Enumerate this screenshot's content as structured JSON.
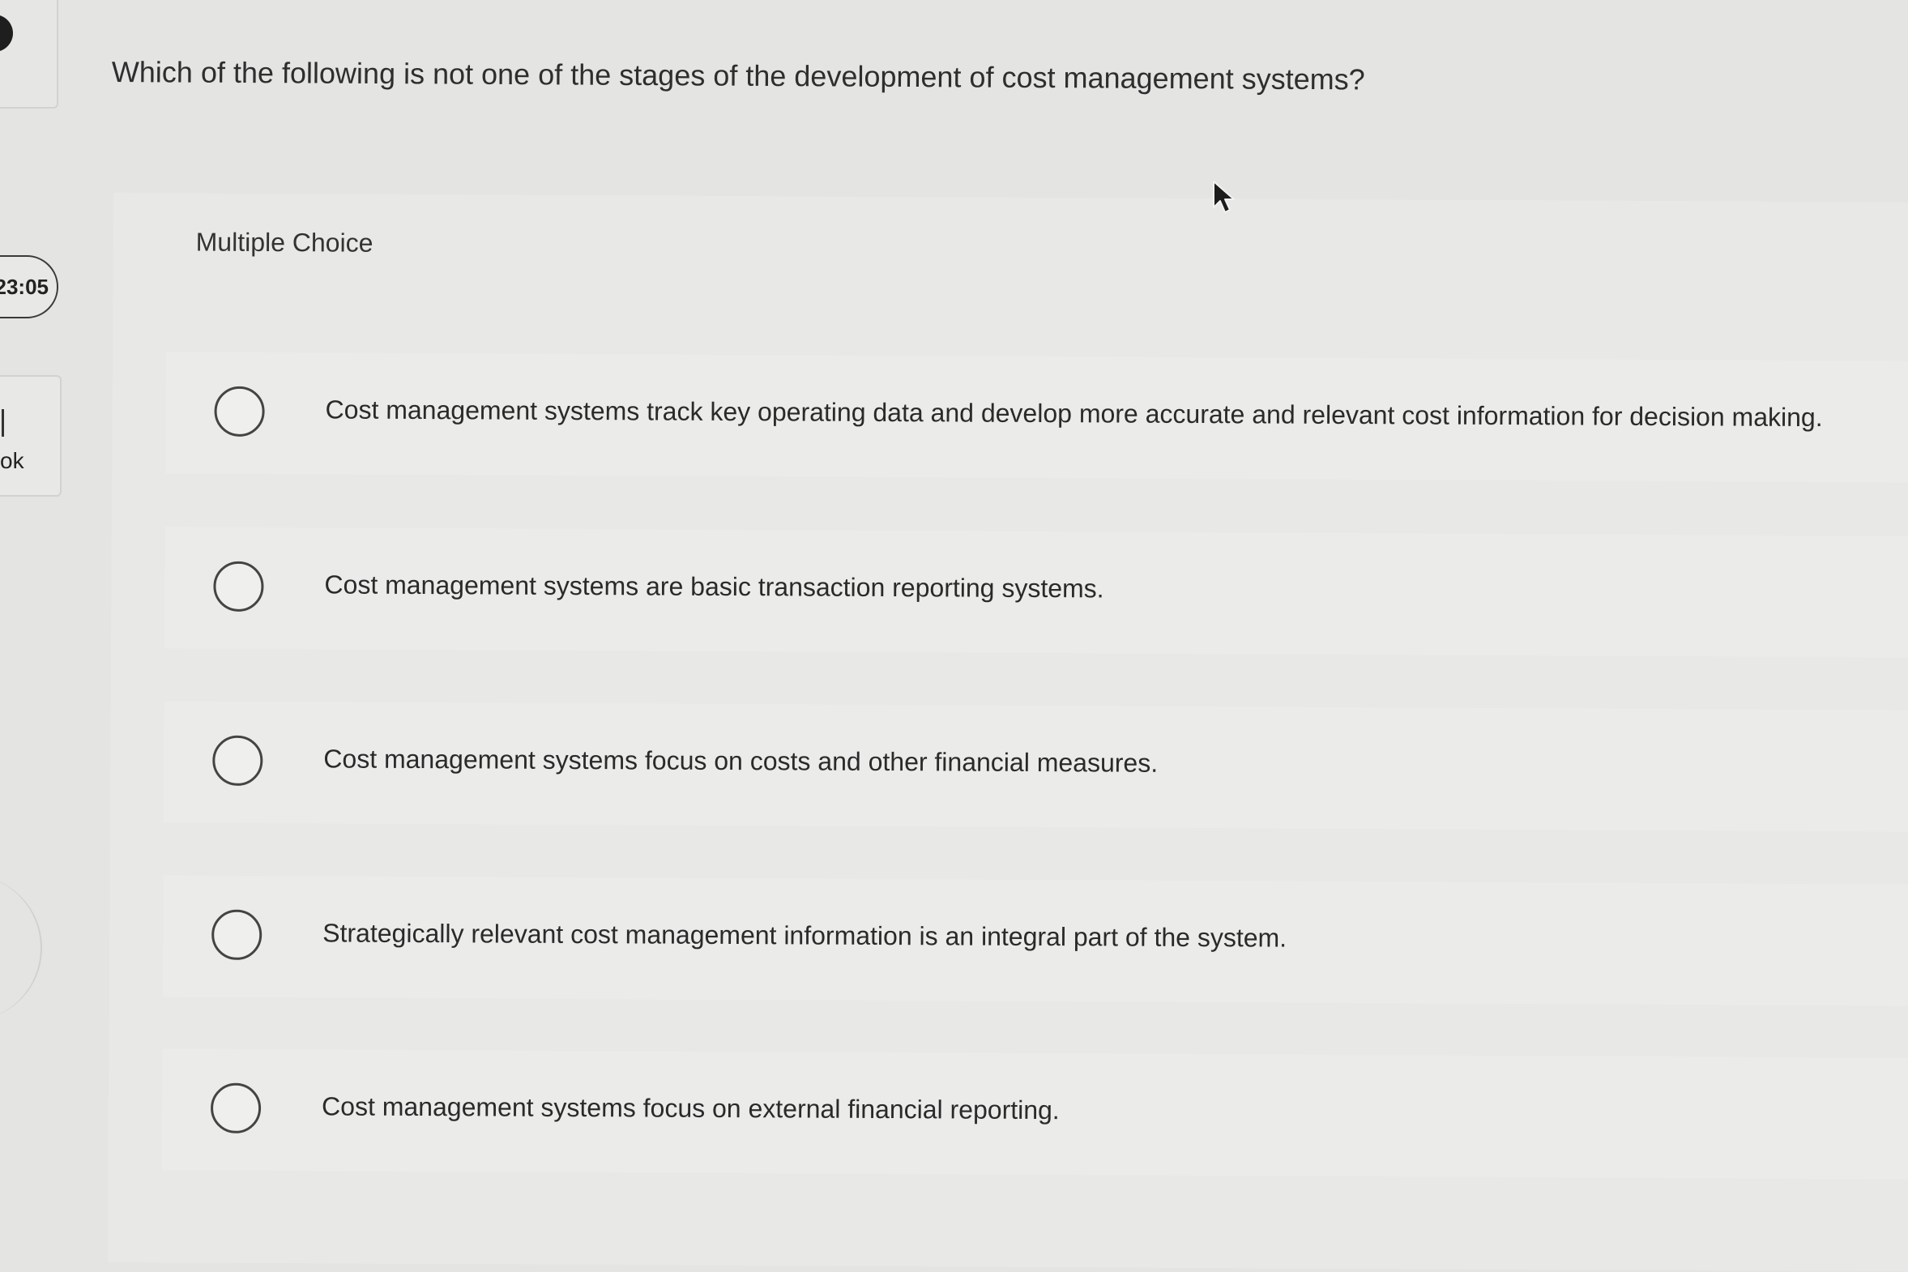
{
  "sidebar": {
    "timer": "23:05",
    "tool_label": "ok"
  },
  "question": {
    "prompt": "Which of the following is not one of the stages of the development of cost management systems?",
    "type": "Multiple Choice",
    "choices": [
      "Cost management systems track key operating data and develop more accurate and relevant cost information for decision making.",
      "Cost management systems are basic transaction reporting systems.",
      "Cost management systems focus on costs and other financial measures.",
      "Strategically relevant cost management information is an integral part of the system.",
      "Cost management systems focus on external financial reporting."
    ],
    "selected_index": null
  },
  "icons": {
    "choice": "radio-unselected-icon",
    "cursor": "arrow-cursor-icon"
  }
}
